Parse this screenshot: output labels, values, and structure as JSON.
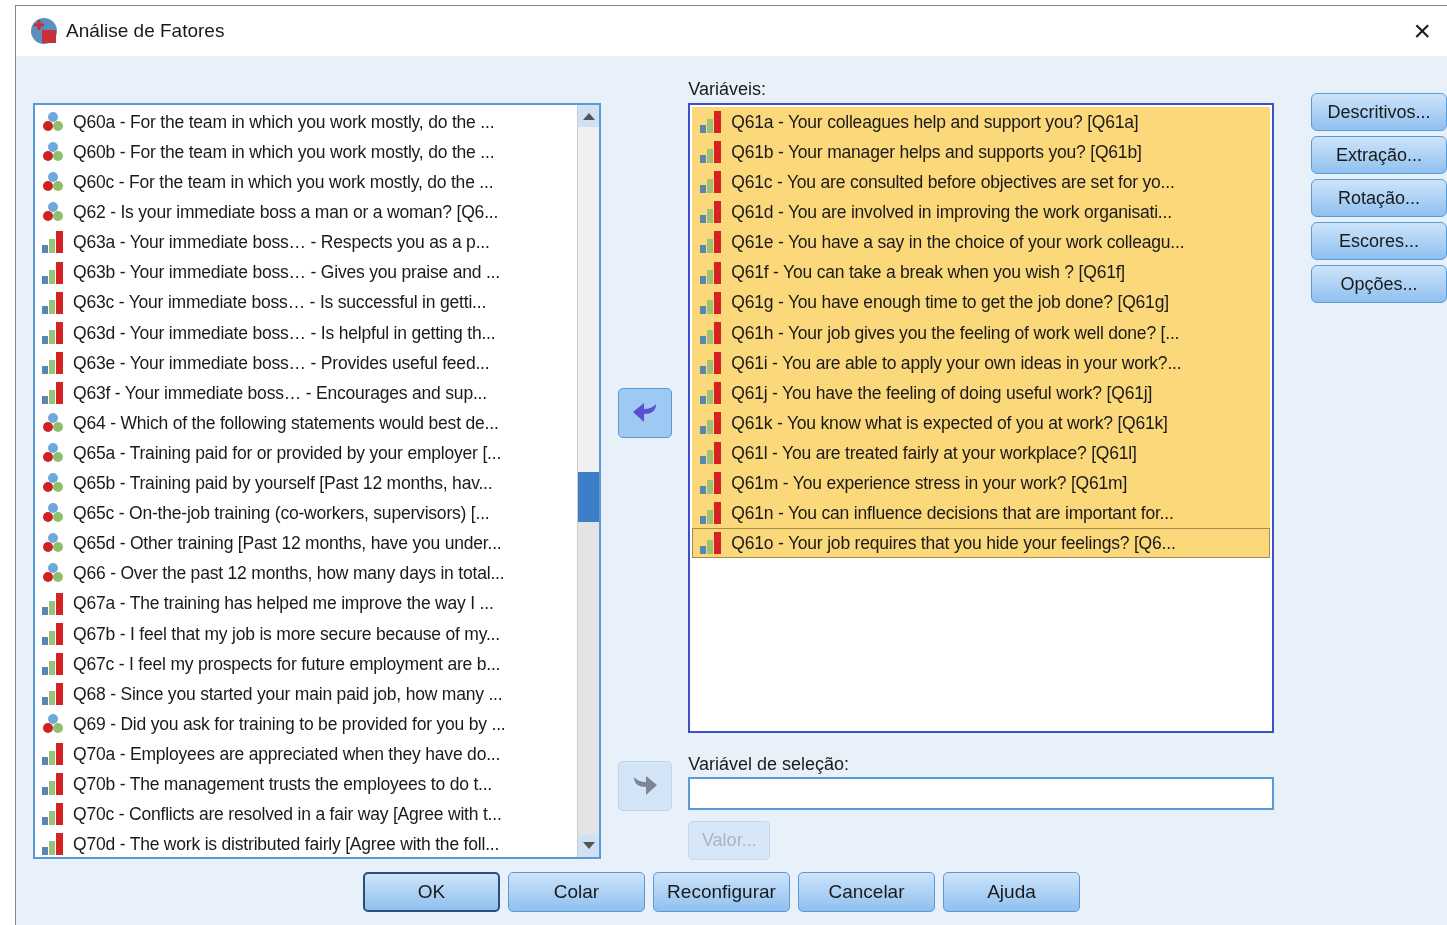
{
  "window": {
    "title": "Análise de Fatores",
    "close": "×"
  },
  "source_list": {
    "items": [
      {
        "kind": "nominal",
        "label": "Q60a - For the team in which you work mostly, do the ...",
        "selected": false
      },
      {
        "kind": "nominal",
        "label": "Q60b - For the team in which you work mostly, do the ...",
        "selected": false
      },
      {
        "kind": "nominal",
        "label": "Q60c - For the team in which you work mostly, do the ...",
        "selected": false
      },
      {
        "kind": "nominal",
        "label": "Q62 - Is your immediate boss a man or a woman? [Q6...",
        "selected": false
      },
      {
        "kind": "ordinal",
        "label": "Q63a - Your immediate boss… - Respects you as a p...",
        "selected": false
      },
      {
        "kind": "ordinal",
        "label": "Q63b - Your immediate boss… - Gives you praise and ...",
        "selected": false
      },
      {
        "kind": "ordinal",
        "label": "Q63c - Your immediate boss… - Is successful in getti...",
        "selected": false
      },
      {
        "kind": "ordinal",
        "label": "Q63d - Your immediate boss… - Is helpful in getting th...",
        "selected": false
      },
      {
        "kind": "ordinal",
        "label": "Q63e - Your immediate boss… - Provides useful feed...",
        "selected": false
      },
      {
        "kind": "ordinal",
        "label": "Q63f - Your immediate boss… - Encourages and sup...",
        "selected": false
      },
      {
        "kind": "nominal",
        "label": "Q64 - Which of the following statements would best de...",
        "selected": false
      },
      {
        "kind": "nominal",
        "label": "Q65a - Training paid for or provided by your employer [...",
        "selected": false
      },
      {
        "kind": "nominal",
        "label": "Q65b - Training paid by yourself [Past 12 months, hav...",
        "selected": false
      },
      {
        "kind": "nominal",
        "label": "Q65c - On-the-job training (co-workers, supervisors) [...",
        "selected": false
      },
      {
        "kind": "nominal",
        "label": "Q65d - Other training [Past 12 months, have you under...",
        "selected": false
      },
      {
        "kind": "nominal",
        "label": "Q66 - Over the past 12 months, how many days in total...",
        "selected": false
      },
      {
        "kind": "ordinal",
        "label": "Q67a - The training has helped me improve the way I ...",
        "selected": false
      },
      {
        "kind": "ordinal",
        "label": "Q67b - I feel that my job is more secure because of my...",
        "selected": false
      },
      {
        "kind": "ordinal",
        "label": "Q67c - I feel my prospects for future employment are b...",
        "selected": false
      },
      {
        "kind": "ordinal",
        "label": "Q68 - Since you started your main paid job, how many ...",
        "selected": false
      },
      {
        "kind": "nominal",
        "label": "Q69 - Did you ask for training to be provided for you by ...",
        "selected": false
      },
      {
        "kind": "ordinal",
        "label": "Q70a - Employees are appreciated when they have do...",
        "selected": false
      },
      {
        "kind": "ordinal",
        "label": "Q70b - The management trusts the employees to do t...",
        "selected": false
      },
      {
        "kind": "ordinal",
        "label": "Q70c - Conflicts are resolved in a fair way [Agree with t...",
        "selected": false
      },
      {
        "kind": "ordinal",
        "label": "Q70d - The work is distributed fairly [Agree with the foll...",
        "selected": false
      }
    ]
  },
  "move_buttons": [
    {
      "disabled": false
    },
    {
      "disabled": true
    }
  ],
  "variables": {
    "label": "Variáveis:",
    "items": [
      {
        "kind": "ordinal",
        "label": "Q61a - Your colleagues help and support you? [Q61a]",
        "selected": true,
        "focused": false
      },
      {
        "kind": "ordinal",
        "label": "Q61b - Your manager helps and supports you? [Q61b]",
        "selected": true,
        "focused": false
      },
      {
        "kind": "ordinal",
        "label": "Q61c - You are consulted before objectives are set for yo...",
        "selected": true,
        "focused": false
      },
      {
        "kind": "ordinal",
        "label": "Q61d - You are involved in improving the work organisati...",
        "selected": true,
        "focused": false
      },
      {
        "kind": "ordinal",
        "label": "Q61e - You have a say in the choice of your work colleagu...",
        "selected": true,
        "focused": false
      },
      {
        "kind": "ordinal",
        "label": "Q61f - You can take a break when you wish ? [Q61f]",
        "selected": true,
        "focused": false
      },
      {
        "kind": "ordinal",
        "label": "Q61g - You have enough time to get the job done? [Q61g]",
        "selected": true,
        "focused": false
      },
      {
        "kind": "ordinal",
        "label": "Q61h - Your job gives you the feeling of work well done? [...",
        "selected": true,
        "focused": false
      },
      {
        "kind": "ordinal",
        "label": "Q61i - You are able to apply your own ideas in your work?...",
        "selected": true,
        "focused": false
      },
      {
        "kind": "ordinal",
        "label": "Q61j - You have the feeling of doing useful work? [Q61j]",
        "selected": true,
        "focused": false
      },
      {
        "kind": "ordinal",
        "label": "Q61k - You know what is expected of you at work? [Q61k]",
        "selected": true,
        "focused": false
      },
      {
        "kind": "ordinal",
        "label": "Q61l - You are treated fairly at your workplace? [Q61l]",
        "selected": true,
        "focused": false
      },
      {
        "kind": "ordinal",
        "label": "Q61m - You experience stress in your work? [Q61m]",
        "selected": true,
        "focused": false
      },
      {
        "kind": "ordinal",
        "label": "Q61n - You can influence decisions that are important for...",
        "selected": true,
        "focused": false
      },
      {
        "kind": "ordinal",
        "label": "Q61o - Your job requires that you hide your feelings? [Q6...",
        "selected": true,
        "focused": true
      }
    ]
  },
  "selection_variable": {
    "label": "Variável de seleção:",
    "value_button": {
      "label": "Valor...",
      "disabled": true
    }
  },
  "side_buttons": [
    {
      "label": "Descritivos..."
    },
    {
      "label": "Extração..."
    },
    {
      "label": "Rotação..."
    },
    {
      "label": "Escores..."
    },
    {
      "label": "Opções..."
    }
  ],
  "footer_buttons": [
    {
      "label": "OK",
      "default": true
    },
    {
      "label": "Colar",
      "default": false
    },
    {
      "label": "Reconfigurar",
      "default": false
    },
    {
      "label": "Cancelar",
      "default": false
    },
    {
      "label": "Ajuda",
      "default": false
    }
  ]
}
